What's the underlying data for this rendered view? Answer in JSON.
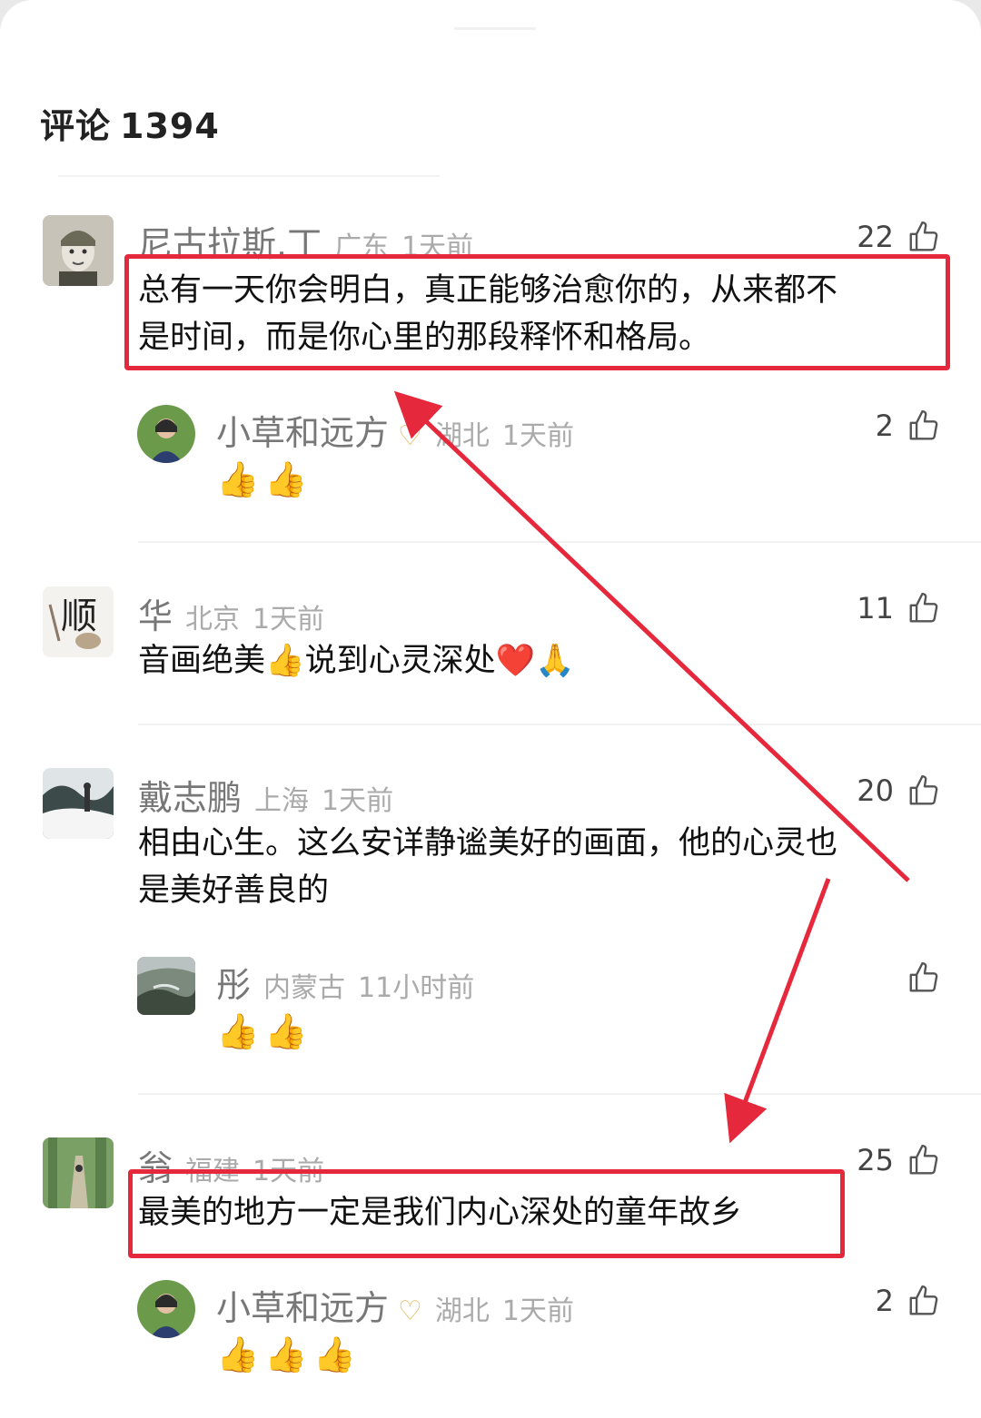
{
  "header": {
    "title": "评论",
    "count": "1394"
  },
  "comments": [
    {
      "name": "尼古拉斯.丁",
      "location": "广东",
      "time": "1天前",
      "likes": "22",
      "text_line1": "总有一天你会明白，真正能够治愈你的，从来都不",
      "text_line2": "是时间，而是你心里的那段释怀和格局。",
      "reply": {
        "name": "小草和远方",
        "badge": "♡",
        "location": "湖北",
        "time": "1天前",
        "likes": "2",
        "emojis": [
          "👍",
          "👍"
        ]
      }
    },
    {
      "name": "华",
      "location": "北京",
      "time": "1天前",
      "likes": "11",
      "text_line1": "音画绝美👍说到心灵深处❤️🙏"
    },
    {
      "name": "戴志鹏",
      "location": "上海",
      "time": "1天前",
      "likes": "20",
      "text_line1": "相由心生。这么安详静谧美好的画面，他的心灵也",
      "text_line2": "是美好善良的",
      "reply": {
        "name": "彤",
        "location": "内蒙古",
        "time": "11小时前",
        "likes": "",
        "emojis": [
          "👍",
          "👍"
        ]
      }
    },
    {
      "name": "翁",
      "location": "福建",
      "time": "1天前",
      "likes": "25",
      "text_line1": "最美的地方一定是我们内心深处的童年故乡",
      "reply": {
        "name": "小草和远方",
        "badge": "♡",
        "location": "湖北",
        "time": "1天前",
        "likes": "2",
        "emojis": [
          "👍",
          "👍",
          "👍"
        ]
      }
    }
  ],
  "colors": {
    "annotation": "#e5283c",
    "meta_text": "#aaaaaa",
    "name_text": "#777777"
  },
  "icons": {
    "like": "thumbs-up-outline-icon"
  }
}
